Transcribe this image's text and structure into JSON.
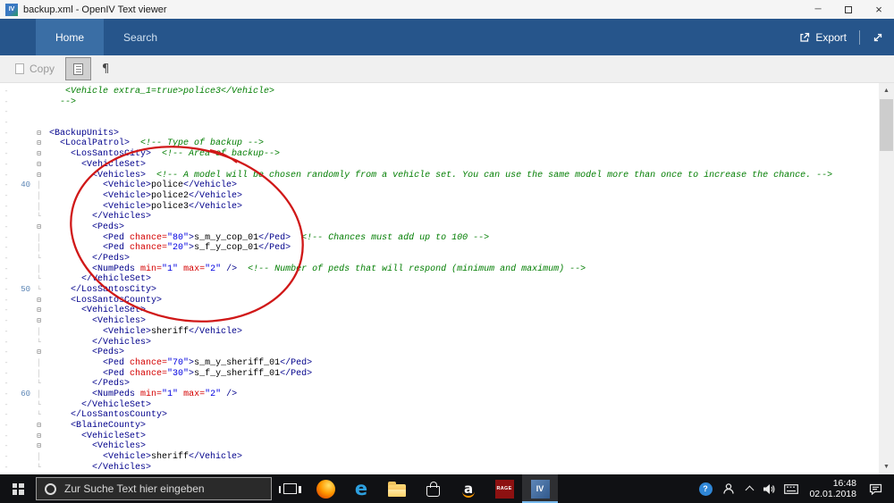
{
  "window": {
    "title": "backup.xml - OpenIV Text viewer",
    "minimize_glyph": "─",
    "close_glyph": "×"
  },
  "ribbon": {
    "tabs": [
      {
        "label": "Home",
        "active": true
      },
      {
        "label": "Search",
        "active": false
      }
    ],
    "export_label": "Export"
  },
  "toolbar": {
    "copy_label": "Copy",
    "pilcrow_glyph": "¶"
  },
  "editor": {
    "fold_glyphs": {
      "o": "⊟",
      "l": "│",
      "e": "└"
    },
    "margin_dash": "-",
    "scroll_up_glyph": "▲",
    "scroll_down_glyph": "▼",
    "line_number_milestones": [
      "40",
      "50",
      "60"
    ],
    "lines": [
      {
        "n": "",
        "f": "",
        "s": [
          [
            "c",
            "   <Vehicle extra_1=true>police3</Vehicle>"
          ]
        ]
      },
      {
        "n": "",
        "f": "",
        "s": [
          [
            "c",
            "  -->"
          ]
        ]
      },
      {
        "n": "",
        "f": "",
        "s": []
      },
      {
        "n": "",
        "f": "",
        "s": []
      },
      {
        "n": "",
        "f": "o",
        "s": [
          [
            "t",
            "<BackupUnits>"
          ]
        ]
      },
      {
        "n": "",
        "f": "o",
        "s": [
          [
            "t",
            "  <LocalPatrol>"
          ],
          [
            "c",
            "  <!-- Type of backup -->"
          ]
        ]
      },
      {
        "n": "",
        "f": "o",
        "s": [
          [
            "t",
            "    <LosSantosCity>"
          ],
          [
            "c",
            "  <!-- Area of backup-->"
          ]
        ]
      },
      {
        "n": "",
        "f": "o",
        "s": [
          [
            "t",
            "      <VehicleSet>"
          ]
        ]
      },
      {
        "n": "",
        "f": "o",
        "s": [
          [
            "t",
            "        <Vehicles>"
          ],
          [
            "c",
            "  <!-- A model will be chosen randomly from a vehicle set. You can use the same model more than once to increase the chance. -->"
          ]
        ]
      },
      {
        "n": "40",
        "f": "l",
        "s": [
          [
            "t",
            "          <Vehicle>"
          ],
          [
            "x",
            "police"
          ],
          [
            "t",
            "</Vehicle>"
          ]
        ]
      },
      {
        "n": "",
        "f": "l",
        "s": [
          [
            "t",
            "          <Vehicle>"
          ],
          [
            "x",
            "police2"
          ],
          [
            "t",
            "</Vehicle>"
          ]
        ]
      },
      {
        "n": "",
        "f": "l",
        "s": [
          [
            "t",
            "          <Vehicle>"
          ],
          [
            "x",
            "police3"
          ],
          [
            "t",
            "</Vehicle>"
          ]
        ]
      },
      {
        "n": "",
        "f": "e",
        "s": [
          [
            "t",
            "        </Vehicles>"
          ]
        ]
      },
      {
        "n": "",
        "f": "o",
        "s": [
          [
            "t",
            "        <Peds>"
          ]
        ]
      },
      {
        "n": "",
        "f": "l",
        "s": [
          [
            "t",
            "          <Ped "
          ],
          [
            "a",
            "chance="
          ],
          [
            "v",
            "\"80\""
          ],
          [
            "t",
            ">"
          ],
          [
            "x",
            "s_m_y_cop_01"
          ],
          [
            "t",
            "</Ped>"
          ],
          [
            "c",
            "  <!-- Chances must add up to 100 -->"
          ]
        ]
      },
      {
        "n": "",
        "f": "l",
        "s": [
          [
            "t",
            "          <Ped "
          ],
          [
            "a",
            "chance="
          ],
          [
            "v",
            "\"20\""
          ],
          [
            "t",
            ">"
          ],
          [
            "x",
            "s_f_y_cop_01"
          ],
          [
            "t",
            "</Ped>"
          ]
        ]
      },
      {
        "n": "",
        "f": "e",
        "s": [
          [
            "t",
            "        </Peds>"
          ]
        ]
      },
      {
        "n": "",
        "f": "l",
        "s": [
          [
            "t",
            "        <NumPeds "
          ],
          [
            "a",
            "min="
          ],
          [
            "v",
            "\"1\""
          ],
          [
            "a",
            " max="
          ],
          [
            "v",
            "\"2\""
          ],
          [
            "t",
            " />"
          ],
          [
            "c",
            "  <!-- Number of peds that will respond (minimum and maximum) -->"
          ]
        ]
      },
      {
        "n": "",
        "f": "e",
        "s": [
          [
            "t",
            "      </VehicleSet>"
          ]
        ]
      },
      {
        "n": "50",
        "f": "e",
        "s": [
          [
            "t",
            "    </LosSantosCity>"
          ]
        ]
      },
      {
        "n": "",
        "f": "o",
        "s": [
          [
            "t",
            "    <LosSantosCounty>"
          ]
        ]
      },
      {
        "n": "",
        "f": "o",
        "s": [
          [
            "t",
            "      <VehicleSet>"
          ]
        ]
      },
      {
        "n": "",
        "f": "o",
        "s": [
          [
            "t",
            "        <Vehicles>"
          ]
        ]
      },
      {
        "n": "",
        "f": "l",
        "s": [
          [
            "t",
            "          <Vehicle>"
          ],
          [
            "x",
            "sheriff"
          ],
          [
            "t",
            "</Vehicle>"
          ]
        ]
      },
      {
        "n": "",
        "f": "e",
        "s": [
          [
            "t",
            "        </Vehicles>"
          ]
        ]
      },
      {
        "n": "",
        "f": "o",
        "s": [
          [
            "t",
            "        <Peds>"
          ]
        ]
      },
      {
        "n": "",
        "f": "l",
        "s": [
          [
            "t",
            "          <Ped "
          ],
          [
            "a",
            "chance="
          ],
          [
            "v",
            "\"70\""
          ],
          [
            "t",
            ">"
          ],
          [
            "x",
            "s_m_y_sheriff_01"
          ],
          [
            "t",
            "</Ped>"
          ]
        ]
      },
      {
        "n": "",
        "f": "l",
        "s": [
          [
            "t",
            "          <Ped "
          ],
          [
            "a",
            "chance="
          ],
          [
            "v",
            "\"30\""
          ],
          [
            "t",
            ">"
          ],
          [
            "x",
            "s_f_y_sheriff_01"
          ],
          [
            "t",
            "</Ped>"
          ]
        ]
      },
      {
        "n": "",
        "f": "e",
        "s": [
          [
            "t",
            "        </Peds>"
          ]
        ]
      },
      {
        "n": "60",
        "f": "l",
        "s": [
          [
            "t",
            "        <NumPeds "
          ],
          [
            "a",
            "min="
          ],
          [
            "v",
            "\"1\""
          ],
          [
            "a",
            " max="
          ],
          [
            "v",
            "\"2\""
          ],
          [
            "t",
            " />"
          ]
        ]
      },
      {
        "n": "",
        "f": "e",
        "s": [
          [
            "t",
            "      </VehicleSet>"
          ]
        ]
      },
      {
        "n": "",
        "f": "e",
        "s": [
          [
            "t",
            "    </LosSantosCounty>"
          ]
        ]
      },
      {
        "n": "",
        "f": "o",
        "s": [
          [
            "t",
            "    <BlaineCounty>"
          ]
        ]
      },
      {
        "n": "",
        "f": "o",
        "s": [
          [
            "t",
            "      <VehicleSet>"
          ]
        ]
      },
      {
        "n": "",
        "f": "o",
        "s": [
          [
            "t",
            "        <Vehicles>"
          ]
        ]
      },
      {
        "n": "",
        "f": "l",
        "s": [
          [
            "t",
            "          <Vehicle>"
          ],
          [
            "x",
            "sheriff"
          ],
          [
            "t",
            "</Vehicle>"
          ]
        ]
      },
      {
        "n": "",
        "f": "e",
        "s": [
          [
            "t",
            "        </Vehicles>"
          ]
        ]
      }
    ]
  },
  "annotation": {
    "shape": "hand-drawn-ellipse",
    "color": "#d01818"
  },
  "taskbar": {
    "search_text": "Zur Suche Text hier eingeben",
    "apps": [
      {
        "id": "task-view"
      },
      {
        "id": "firefox"
      },
      {
        "id": "edge",
        "label": "e"
      },
      {
        "id": "explorer"
      },
      {
        "id": "store"
      },
      {
        "id": "amazon",
        "label": "a"
      },
      {
        "id": "rage",
        "label": "RAGE"
      },
      {
        "id": "openiv",
        "label": "IV",
        "active": true
      }
    ],
    "tray": {
      "help_glyph": "?",
      "time": "16:48",
      "date": "02.01.2018"
    }
  }
}
